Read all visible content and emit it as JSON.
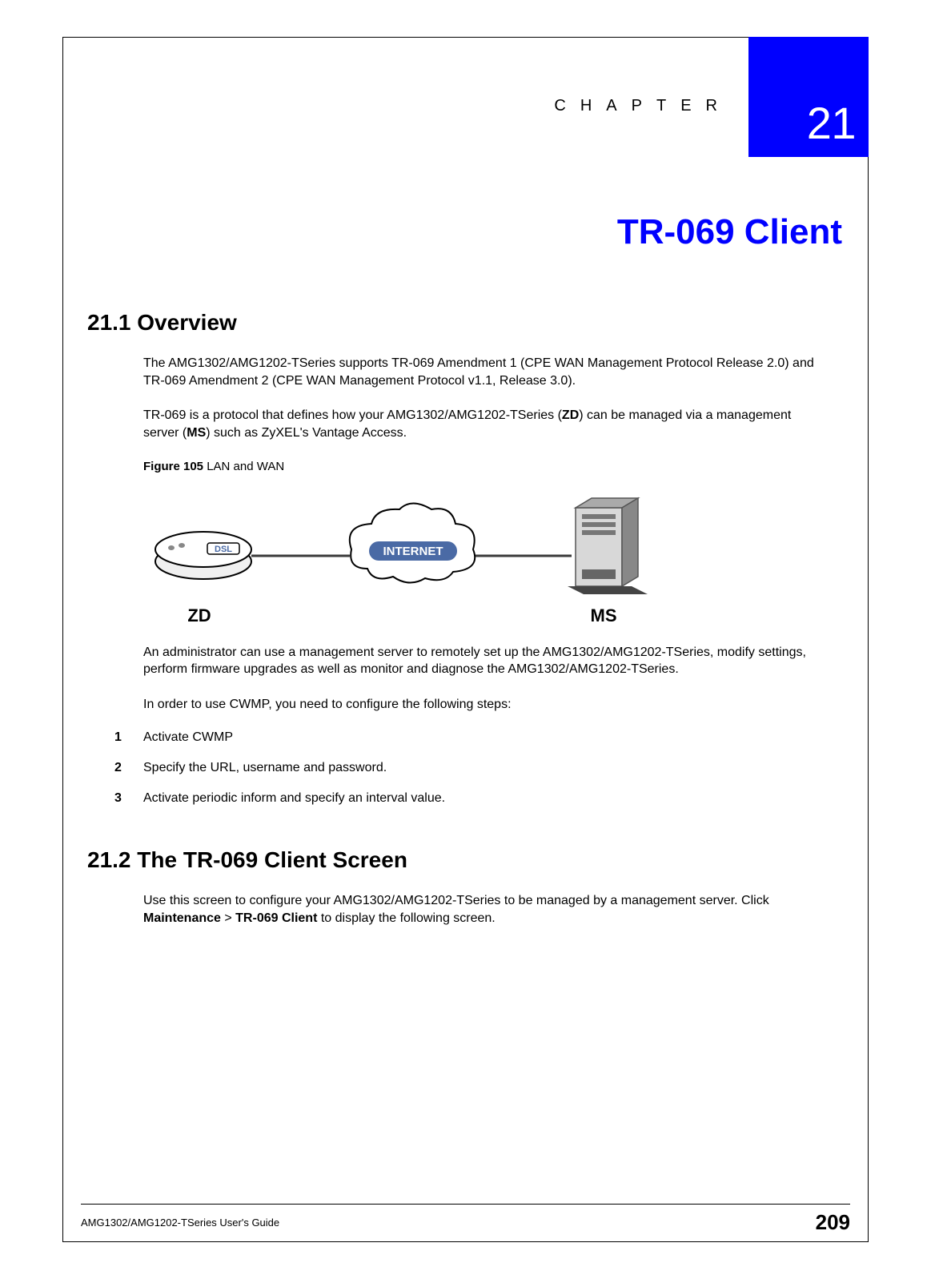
{
  "chapter": {
    "label": "CHAPTER",
    "number": "21",
    "title": "TR-069 Client"
  },
  "section1": {
    "heading": "21.1  Overview",
    "para1": "The AMG1302/AMG1202-TSeries supports TR-069 Amendment 1 (CPE WAN Management Protocol Release 2.0) and TR-069 Amendment 2 (CPE WAN Management Protocol v1.1, Release 3.0).",
    "para2_pre": "TR-069 is a protocol that defines how your AMG1302/AMG1202-TSeries (",
    "para2_zd": "ZD",
    "para2_mid": ") can be managed via a management server (",
    "para2_ms": "MS",
    "para2_post": ") such as ZyXEL's Vantage Access.",
    "figure_label": "Figure 105",
    "figure_caption": "   LAN and WAN",
    "diagram": {
      "zd_label": "ZD",
      "ms_label": "MS",
      "dsl_text": "DSL",
      "internet_text": "INTERNET"
    },
    "para3": "An administrator can use a management server to remotely set up the AMG1302/AMG1202-TSeries, modify settings, perform firmware upgrades as well as monitor and diagnose the AMG1302/AMG1202-TSeries.",
    "para4": "In order to use CWMP, you need to configure the following steps:",
    "steps": [
      {
        "n": "1",
        "t": "Activate CWMP"
      },
      {
        "n": "2",
        "t": "Specify the URL, username and password."
      },
      {
        "n": "3",
        "t": "Activate periodic inform and specify an interval value."
      }
    ]
  },
  "section2": {
    "heading": "21.2  The TR-069 Client Screen",
    "para1_pre": "Use this screen to configure your AMG1302/AMG1202-TSeries to be managed by a management server. Click ",
    "para1_b1": "Maintenance",
    "para1_mid": " > ",
    "para1_b2": "TR-069 Client",
    "para1_post": " to display the following screen."
  },
  "footer": {
    "guide": "AMG1302/AMG1202-TSeries User's Guide",
    "page": "209"
  }
}
